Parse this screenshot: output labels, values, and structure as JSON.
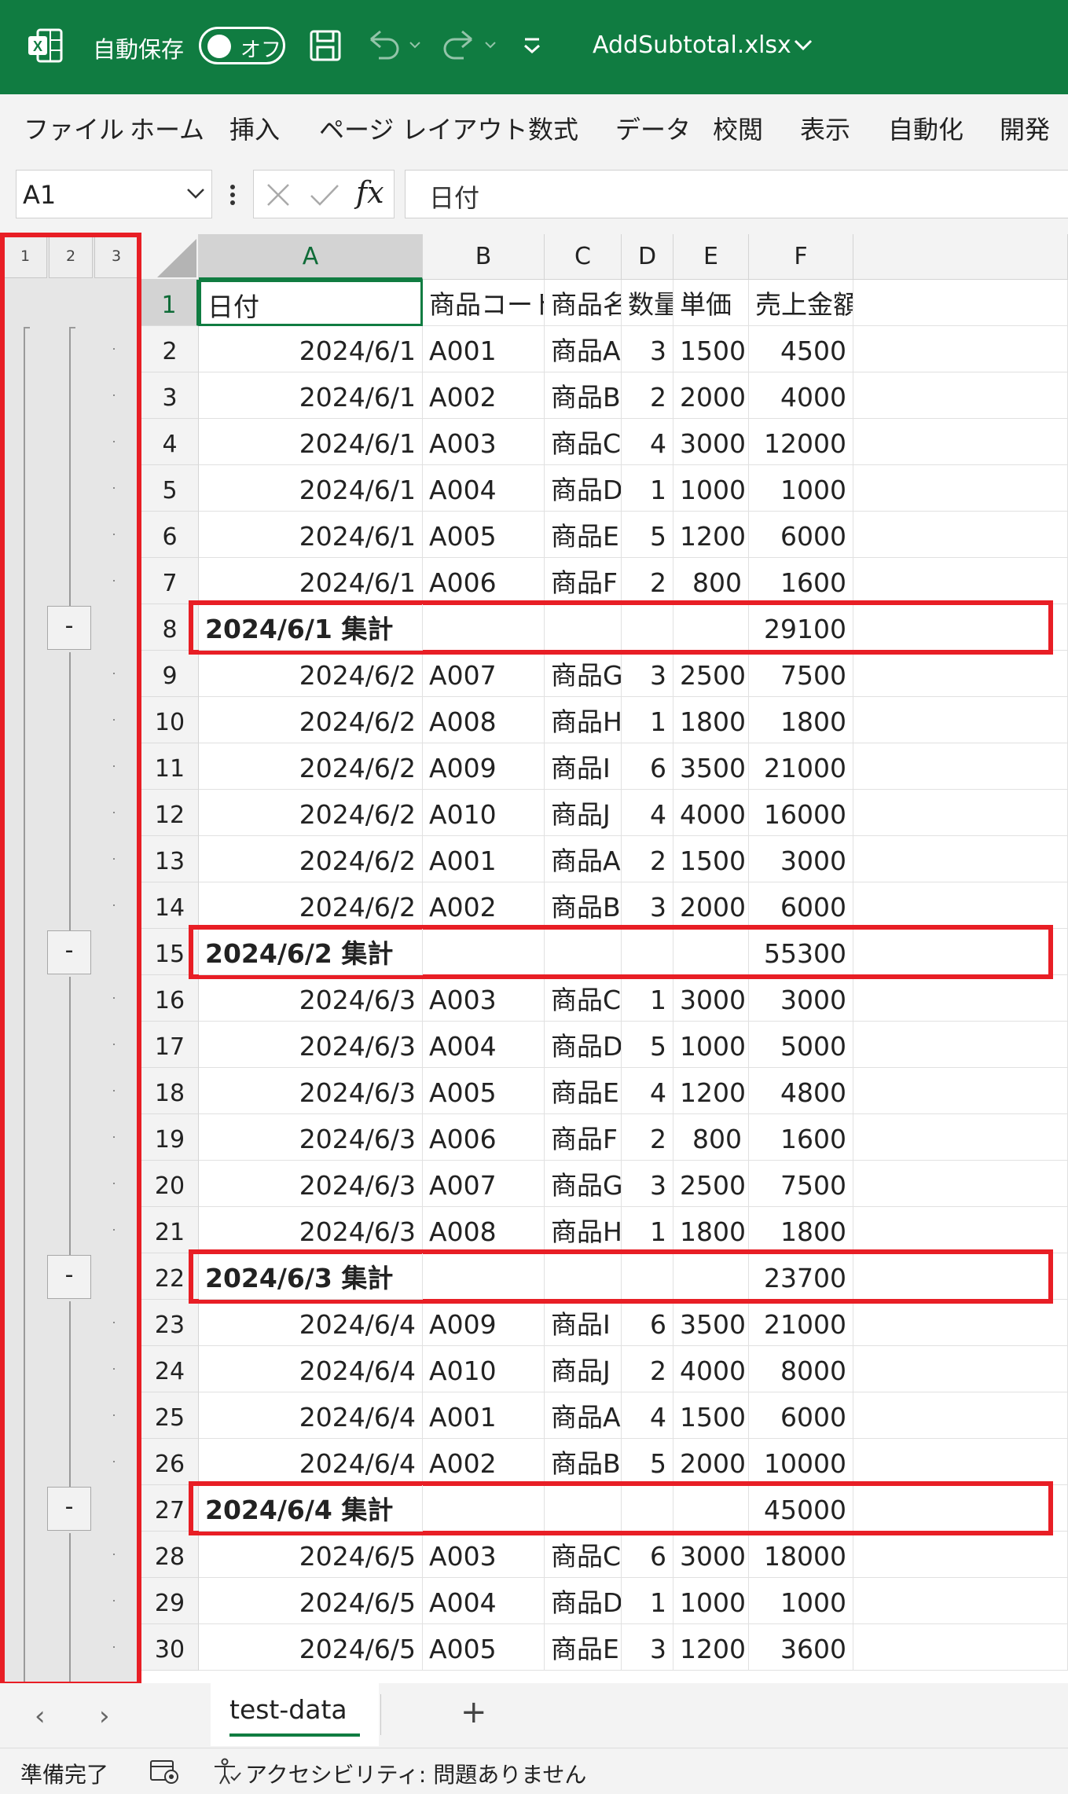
{
  "titlebar": {
    "autosave_label": "自動保存",
    "autosave_state": "オフ",
    "filename": "AddSubtotal.xlsx",
    "accent_color": "#107c41"
  },
  "ribbon": {
    "tabs": [
      "ファイル",
      "ホーム",
      "挿入",
      "ページ レイアウト",
      "数式",
      "データ",
      "校閲",
      "表示",
      "自動化",
      "開発"
    ]
  },
  "formula_bar": {
    "name_box": "A1",
    "formula": "日付",
    "fx_label": "fx"
  },
  "outline": {
    "levels": [
      "1",
      "2",
      "3"
    ],
    "collapse_symbol": "-"
  },
  "grid": {
    "columns": [
      "A",
      "B",
      "C",
      "D",
      "E",
      "F"
    ],
    "selected_column": "A",
    "selected_row": "1",
    "rows": [
      {
        "n": "1",
        "cells": [
          "日付",
          "商品コード",
          "商品名",
          "数量",
          "単価",
          "売上金額"
        ],
        "kind": "header"
      },
      {
        "n": "2",
        "cells": [
          "2024/6/1",
          "A001",
          "商品A",
          "3",
          "1500",
          "4500"
        ]
      },
      {
        "n": "3",
        "cells": [
          "2024/6/1",
          "A002",
          "商品B",
          "2",
          "2000",
          "4000"
        ]
      },
      {
        "n": "4",
        "cells": [
          "2024/6/1",
          "A003",
          "商品C",
          "4",
          "3000",
          "12000"
        ]
      },
      {
        "n": "5",
        "cells": [
          "2024/6/1",
          "A004",
          "商品D",
          "1",
          "1000",
          "1000"
        ]
      },
      {
        "n": "6",
        "cells": [
          "2024/6/1",
          "A005",
          "商品E",
          "5",
          "1200",
          "6000"
        ]
      },
      {
        "n": "7",
        "cells": [
          "2024/6/1",
          "A006",
          "商品F",
          "2",
          "800",
          "1600"
        ]
      },
      {
        "n": "8",
        "cells": [
          "2024/6/1 集計",
          "",
          "",
          "",
          "",
          "29100"
        ],
        "kind": "subtotal"
      },
      {
        "n": "9",
        "cells": [
          "2024/6/2",
          "A007",
          "商品G",
          "3",
          "2500",
          "7500"
        ]
      },
      {
        "n": "10",
        "cells": [
          "2024/6/2",
          "A008",
          "商品H",
          "1",
          "1800",
          "1800"
        ]
      },
      {
        "n": "11",
        "cells": [
          "2024/6/2",
          "A009",
          "商品I",
          "6",
          "3500",
          "21000"
        ]
      },
      {
        "n": "12",
        "cells": [
          "2024/6/2",
          "A010",
          "商品J",
          "4",
          "4000",
          "16000"
        ]
      },
      {
        "n": "13",
        "cells": [
          "2024/6/2",
          "A001",
          "商品A",
          "2",
          "1500",
          "3000"
        ]
      },
      {
        "n": "14",
        "cells": [
          "2024/6/2",
          "A002",
          "商品B",
          "3",
          "2000",
          "6000"
        ]
      },
      {
        "n": "15",
        "cells": [
          "2024/6/2 集計",
          "",
          "",
          "",
          "",
          "55300"
        ],
        "kind": "subtotal"
      },
      {
        "n": "16",
        "cells": [
          "2024/6/3",
          "A003",
          "商品C",
          "1",
          "3000",
          "3000"
        ]
      },
      {
        "n": "17",
        "cells": [
          "2024/6/3",
          "A004",
          "商品D",
          "5",
          "1000",
          "5000"
        ]
      },
      {
        "n": "18",
        "cells": [
          "2024/6/3",
          "A005",
          "商品E",
          "4",
          "1200",
          "4800"
        ]
      },
      {
        "n": "19",
        "cells": [
          "2024/6/3",
          "A006",
          "商品F",
          "2",
          "800",
          "1600"
        ]
      },
      {
        "n": "20",
        "cells": [
          "2024/6/3",
          "A007",
          "商品G",
          "3",
          "2500",
          "7500"
        ]
      },
      {
        "n": "21",
        "cells": [
          "2024/6/3",
          "A008",
          "商品H",
          "1",
          "1800",
          "1800"
        ]
      },
      {
        "n": "22",
        "cells": [
          "2024/6/3 集計",
          "",
          "",
          "",
          "",
          "23700"
        ],
        "kind": "subtotal"
      },
      {
        "n": "23",
        "cells": [
          "2024/6/4",
          "A009",
          "商品I",
          "6",
          "3500",
          "21000"
        ]
      },
      {
        "n": "24",
        "cells": [
          "2024/6/4",
          "A010",
          "商品J",
          "2",
          "4000",
          "8000"
        ]
      },
      {
        "n": "25",
        "cells": [
          "2024/6/4",
          "A001",
          "商品A",
          "4",
          "1500",
          "6000"
        ]
      },
      {
        "n": "26",
        "cells": [
          "2024/6/4",
          "A002",
          "商品B",
          "5",
          "2000",
          "10000"
        ]
      },
      {
        "n": "27",
        "cells": [
          "2024/6/4 集計",
          "",
          "",
          "",
          "",
          "45000"
        ],
        "kind": "subtotal"
      },
      {
        "n": "28",
        "cells": [
          "2024/6/5",
          "A003",
          "商品C",
          "6",
          "3000",
          "18000"
        ]
      },
      {
        "n": "29",
        "cells": [
          "2024/6/5",
          "A004",
          "商品D",
          "1",
          "1000",
          "1000"
        ]
      },
      {
        "n": "30",
        "cells": [
          "2024/6/5",
          "A005",
          "商品E",
          "3",
          "1200",
          "3600"
        ]
      }
    ]
  },
  "sheets": {
    "active": "test-data",
    "add_label": "+"
  },
  "status": {
    "ready": "準備完了",
    "accessibility": "アクセシビリティ: 問題ありません"
  },
  "highlight_color": "#e81e25"
}
